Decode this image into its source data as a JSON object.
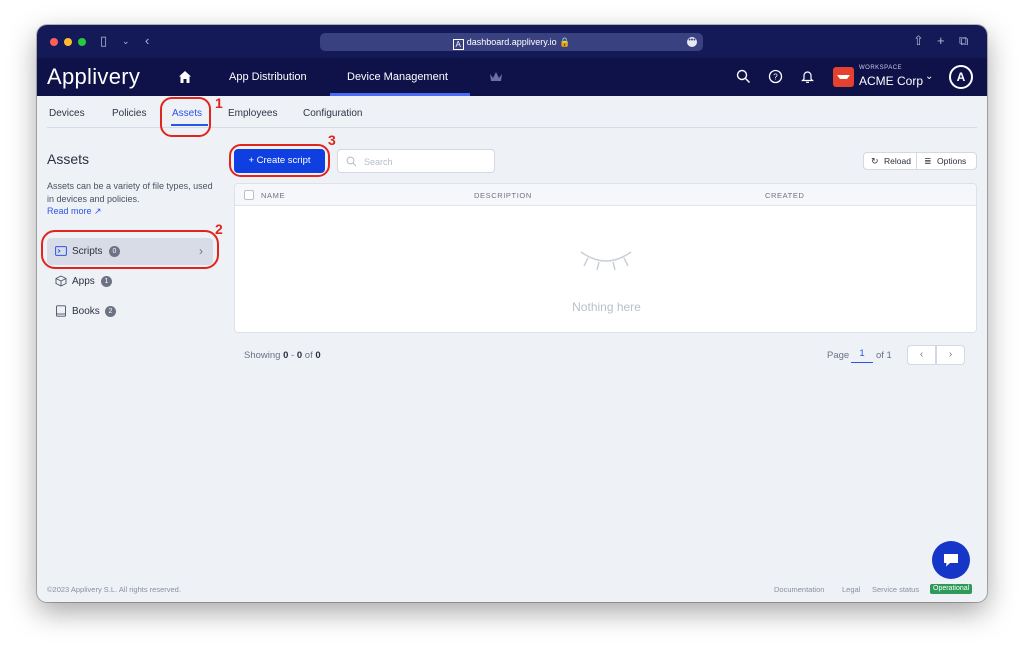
{
  "browser": {
    "url": "dashboard.applivery.io"
  },
  "app": {
    "brand": "Applivery",
    "nav": [
      "App Distribution",
      "Device Management"
    ],
    "workspace_label": "WORKSPACE",
    "workspace_name": "ACME Corp",
    "avatar_letter": "A"
  },
  "subtabs": [
    "Devices",
    "Policies",
    "Assets",
    "Employees",
    "Configuration"
  ],
  "sidebar": {
    "title": "Assets",
    "description": "Assets can be a variety of file types, used in devices and policies.",
    "read_more": "Read more",
    "items": [
      {
        "label": "Scripts",
        "count": "0"
      },
      {
        "label": "Apps",
        "count": "1"
      },
      {
        "label": "Books",
        "count": "2"
      }
    ]
  },
  "toolbar": {
    "create_label": "+ Create script",
    "search_placeholder": "Search",
    "reload_label": "Reload",
    "options_label": "Options"
  },
  "table": {
    "columns": [
      "NAME",
      "DESCRIPTION",
      "CREATED"
    ],
    "empty_text": "Nothing here"
  },
  "pagination": {
    "showing_prefix": "Showing ",
    "from": "0",
    "sep": " - ",
    "to": "0",
    "of_word": " of ",
    "total": "0",
    "page_label": "Page",
    "page": "1",
    "of_pages": "of 1"
  },
  "footer": {
    "copyright": "©2023 Applivery S.L. All rights reserved.",
    "links": [
      "Documentation",
      "Legal",
      "Service status"
    ],
    "status": "Operational"
  },
  "annotations": [
    "1",
    "2",
    "3"
  ],
  "colors": {
    "nav_bg": "#0f1249",
    "accent": "#2b55e6",
    "primary_button": "#0f3fe0",
    "annotation_red": "#e0251c",
    "status_green": "#2d9a57"
  }
}
